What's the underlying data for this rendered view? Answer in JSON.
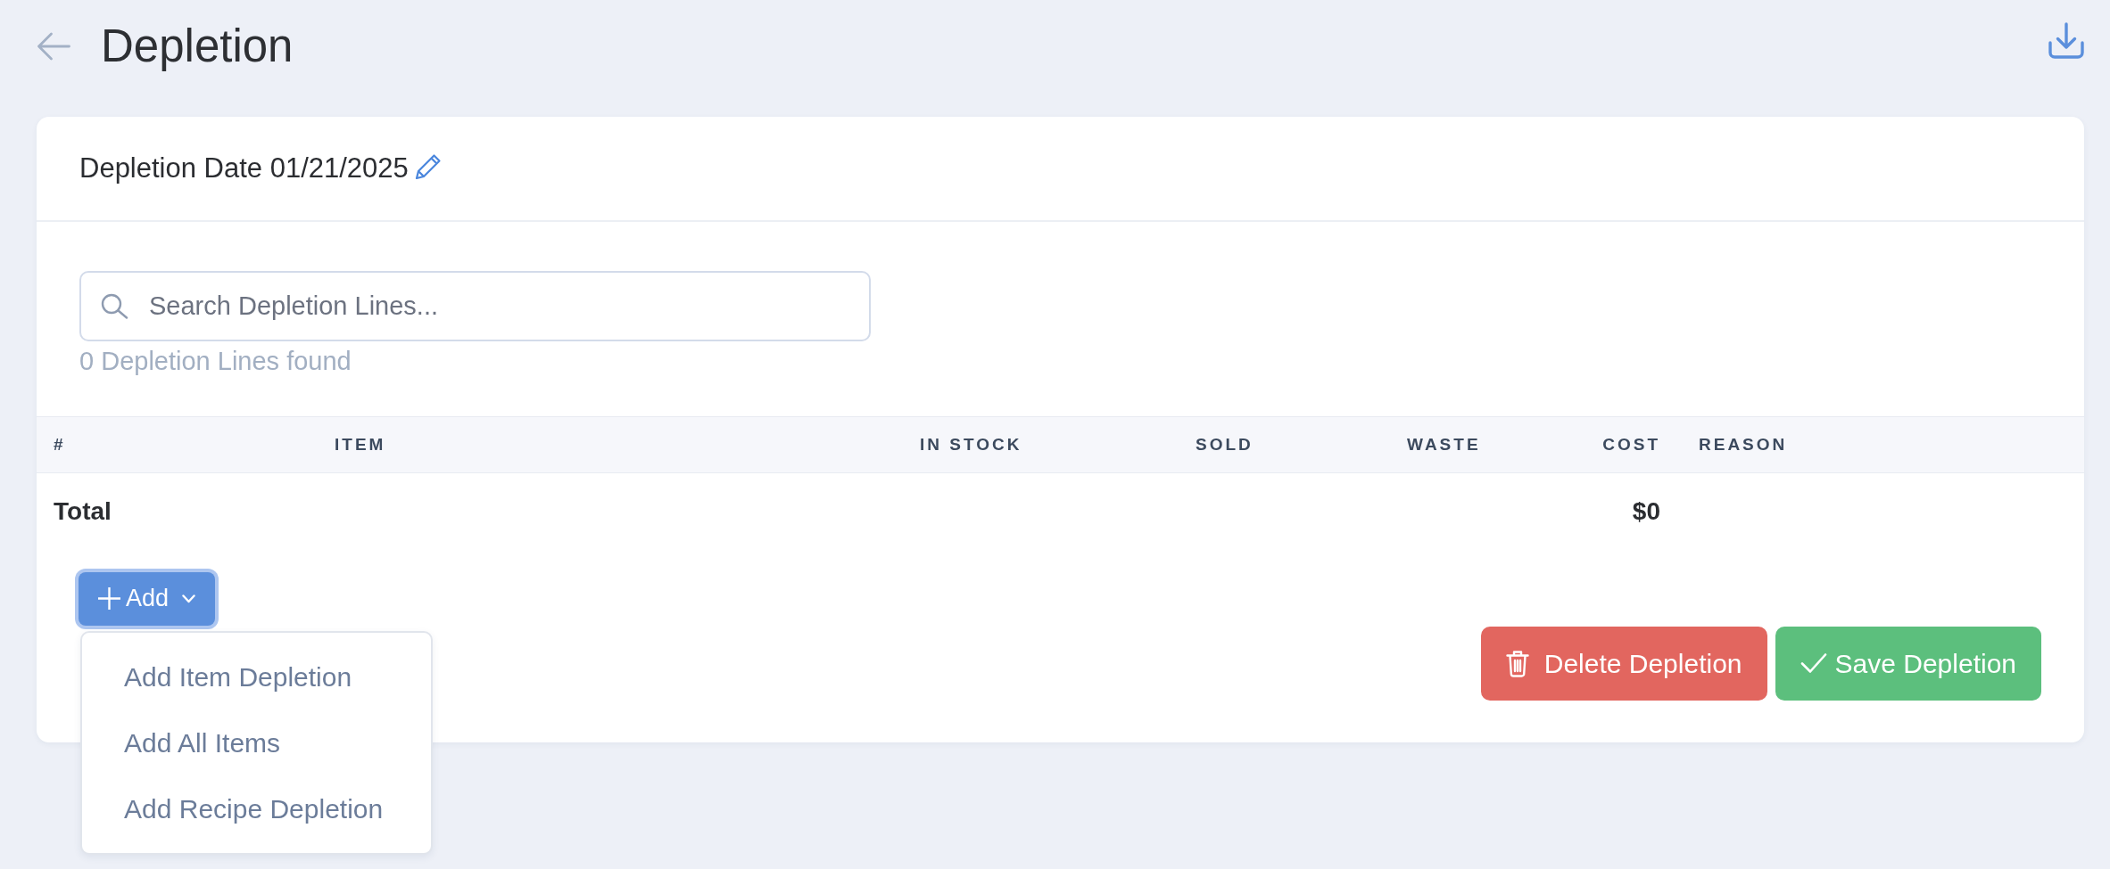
{
  "header": {
    "title": "Depletion"
  },
  "card": {
    "date_text": "Depletion Date 01/21/2025"
  },
  "search": {
    "placeholder": "Search Depletion Lines..."
  },
  "results_count": "0 Depletion Lines found",
  "table": {
    "columns": [
      "#",
      "ITEM",
      "IN STOCK",
      "SOLD",
      "WASTE",
      "COST",
      "REASON"
    ],
    "total_row": {
      "label": "Total",
      "cost": "$0"
    }
  },
  "add_menu": {
    "button": "Add",
    "expanded": true,
    "items": [
      "Add Item Depletion",
      "Add All Items",
      "Add Recipe Depletion"
    ]
  },
  "actions": [
    {
      "kind": "delete",
      "label": "Delete Depletion"
    },
    {
      "kind": "save",
      "label": "Save Depletion"
    }
  ]
}
